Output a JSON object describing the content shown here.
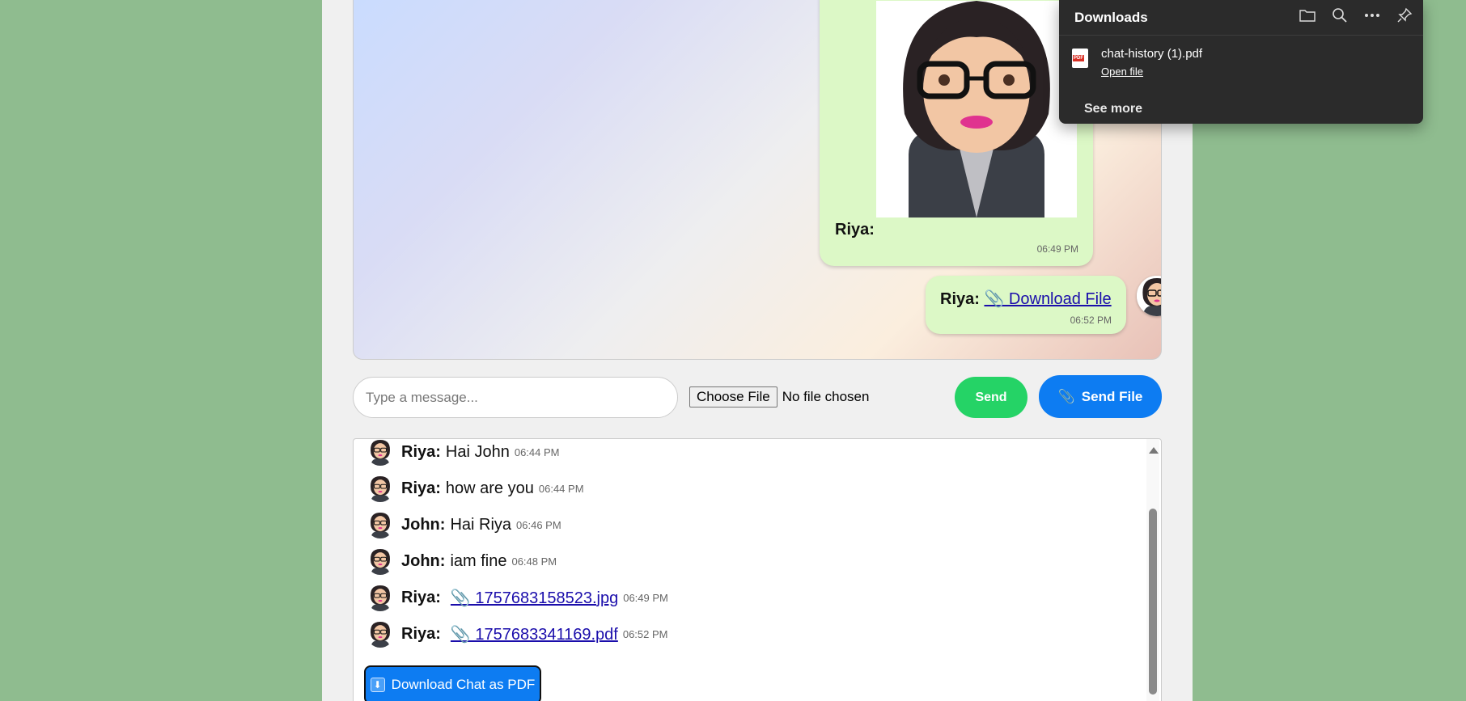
{
  "chat": {
    "image_message": {
      "sender": "Riya:",
      "time": "06:49 PM"
    },
    "file_message": {
      "sender": "Riya:",
      "link_text": "📎 Download File",
      "time": "06:52 PM"
    }
  },
  "composer": {
    "placeholder": "Type a message...",
    "choose_file_label": "Choose File",
    "no_file_text": "No file chosen",
    "send_label": "Send",
    "send_file_label": "Send File",
    "send_file_icon": "📎"
  },
  "history": {
    "rows": [
      {
        "sender": "Riya:",
        "text": "Hai John",
        "time": "06:44 PM"
      },
      {
        "sender": "Riya:",
        "text": "how are you",
        "time": "06:44 PM"
      },
      {
        "sender": "John:",
        "text": "Hai Riya",
        "time": "06:46 PM"
      },
      {
        "sender": "John:",
        "text": "iam fine",
        "time": "06:48 PM"
      },
      {
        "sender": "Riya:",
        "link": "📎 1757683158523.jpg",
        "time": "06:49 PM"
      },
      {
        "sender": "Riya:",
        "link": "📎 1757683341169.pdf",
        "time": "06:52 PM"
      }
    ],
    "download_pdf_label": "Download Chat as PDF",
    "download_pdf_icon": "⬇"
  },
  "downloads": {
    "title": "Downloads",
    "file_name": "chat-history (1).pdf",
    "file_badge": "PDF",
    "open_file": "Open file",
    "see_more": "See more"
  },
  "colors": {
    "page_bg": "#8fbc8f",
    "bubble": "#dcf8c6",
    "send_green": "#25d366",
    "accent_blue": "#0d7cf2",
    "link": "#1a0dab",
    "flyout_bg": "#2b2b2b"
  }
}
